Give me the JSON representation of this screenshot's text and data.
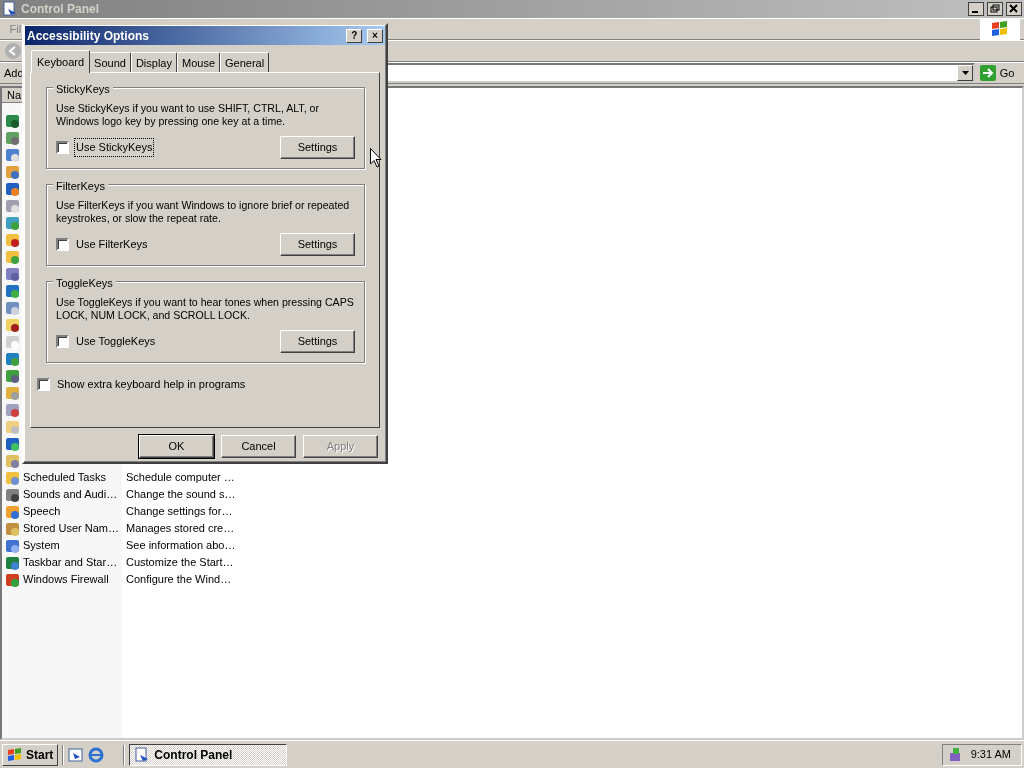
{
  "explorer": {
    "title": "Control Panel",
    "menu": [
      "Fil"
    ],
    "address_label": "Add",
    "go": "Go",
    "column_header": "Na",
    "rows": [
      {
        "name": "Scheduled Tasks",
        "description": "Schedule computer …"
      },
      {
        "name": "Sounds and Audi…",
        "description": "Change the sound s…"
      },
      {
        "name": "Speech",
        "description": "Change settings for…"
      },
      {
        "name": "Stored User Nam…",
        "description": "Manages stored cre…"
      },
      {
        "name": "System",
        "description": "See information abo…"
      },
      {
        "name": "Taskbar and Star…",
        "description": "Customize the Start…"
      },
      {
        "name": "Windows Firewall",
        "description": "Configure the Wind…"
      }
    ]
  },
  "dialog": {
    "title": "Accessibility Options",
    "help": "?",
    "close": "×",
    "tabs": [
      {
        "label": "Keyboard",
        "selected": true
      },
      {
        "label": "Sound",
        "selected": false
      },
      {
        "label": "Display",
        "selected": false
      },
      {
        "label": "Mouse",
        "selected": false
      },
      {
        "label": "General",
        "selected": false
      }
    ],
    "groups": [
      {
        "title": "StickyKeys",
        "text": "Use StickyKeys if you want to use SHIFT, CTRL, ALT, or Windows logo key by pressing one key at a time.",
        "checkbox": {
          "label": "Use StickyKeys",
          "checked": false,
          "focused": true
        },
        "button": "Settings"
      },
      {
        "title": "FilterKeys",
        "text": "Use FilterKeys if you want Windows to ignore brief or repeated keystrokes, or slow the repeat rate.",
        "checkbox": {
          "label": "Use FilterKeys",
          "checked": false,
          "focused": false
        },
        "button": "Settings"
      },
      {
        "title": "ToggleKeys",
        "text": "Use ToggleKeys if you want to hear tones when pressing CAPS LOCK, NUM LOCK, and SCROLL LOCK.",
        "checkbox": {
          "label": "Use ToggleKeys",
          "checked": false,
          "focused": false
        },
        "button": "Settings"
      }
    ],
    "extra_checkbox": {
      "label": "Show extra keyboard help in programs",
      "checked": false
    },
    "buttons": [
      {
        "label": "OK",
        "default": true,
        "disabled": false
      },
      {
        "label": "Cancel",
        "default": false,
        "disabled": false
      },
      {
        "label": "Apply",
        "default": false,
        "disabled": true
      }
    ]
  },
  "taskbar": {
    "start": "Start",
    "tasks": [
      {
        "label": "Control Panel",
        "selected": true
      }
    ],
    "clock": "9:31 AM"
  }
}
